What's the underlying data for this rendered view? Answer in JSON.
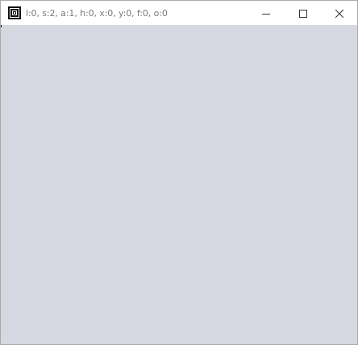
{
  "window": {
    "title": "l:0, s:2, a:1, h:0, x:0, y:0, f:0, o:0",
    "app_icon": "window-app-icon",
    "controls": {
      "minimize_icon": "minimize-icon",
      "maximize_icon": "maximize-icon",
      "close_icon": "close-icon"
    }
  },
  "colors": {
    "client_background": "#d5d8e0",
    "titlebar_background": "#ffffff",
    "title_text": "#7a7a7a"
  }
}
